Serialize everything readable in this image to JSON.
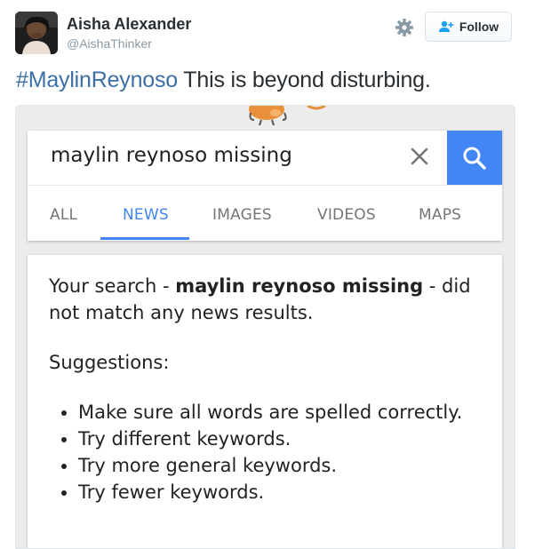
{
  "tweet": {
    "user_name": "Aisha Alexander",
    "user_handle": "@AishaThinker",
    "follow_label": "Follow",
    "hashtag": "#MaylinReynoso",
    "text": " This is beyond disturbing.",
    "avatar_icon": "profile-photo",
    "settings_icon": "gear-icon",
    "follow_icon": "add-user-icon"
  },
  "screenshot": {
    "search_query": "maylin reynoso missing",
    "tabs": [
      {
        "label": "ALL",
        "active": false
      },
      {
        "label": "NEWS",
        "active": true
      },
      {
        "label": "IMAGES",
        "active": false
      },
      {
        "label": "VIDEOS",
        "active": false
      },
      {
        "label": "MAPS",
        "active": false
      }
    ],
    "result": {
      "prefix": "Your search - ",
      "query_bold": "maylin reynoso missing",
      "suffix": " - did not match any news results.",
      "suggestions_title": "Suggestions:",
      "suggestions": [
        "Make sure all words are spelled correctly.",
        "Try different keywords.",
        "Try more general keywords.",
        "Try fewer keywords."
      ]
    }
  },
  "colors": {
    "accent_blue": "#4285f4",
    "hashtag_blue": "#3b6fa6",
    "handle_gray": "#8899a6"
  }
}
